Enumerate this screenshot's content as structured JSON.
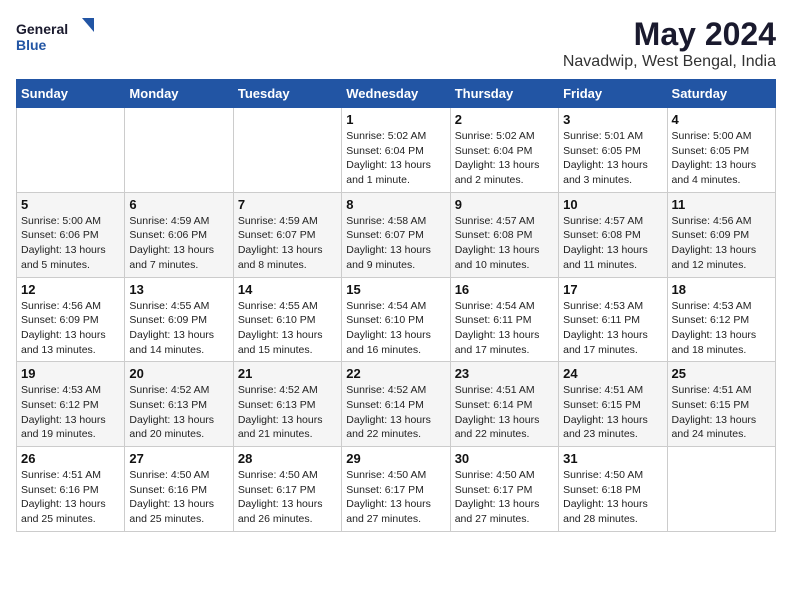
{
  "logo": {
    "line1": "General",
    "line2": "Blue"
  },
  "title": "May 2024",
  "subtitle": "Navadwip, West Bengal, India",
  "headers": [
    "Sunday",
    "Monday",
    "Tuesday",
    "Wednesday",
    "Thursday",
    "Friday",
    "Saturday"
  ],
  "weeks": [
    [
      {
        "day": "",
        "info": ""
      },
      {
        "day": "",
        "info": ""
      },
      {
        "day": "",
        "info": ""
      },
      {
        "day": "1",
        "info": "Sunrise: 5:02 AM\nSunset: 6:04 PM\nDaylight: 13 hours and 1 minute."
      },
      {
        "day": "2",
        "info": "Sunrise: 5:02 AM\nSunset: 6:04 PM\nDaylight: 13 hours and 2 minutes."
      },
      {
        "day": "3",
        "info": "Sunrise: 5:01 AM\nSunset: 6:05 PM\nDaylight: 13 hours and 3 minutes."
      },
      {
        "day": "4",
        "info": "Sunrise: 5:00 AM\nSunset: 6:05 PM\nDaylight: 13 hours and 4 minutes."
      }
    ],
    [
      {
        "day": "5",
        "info": "Sunrise: 5:00 AM\nSunset: 6:06 PM\nDaylight: 13 hours and 5 minutes."
      },
      {
        "day": "6",
        "info": "Sunrise: 4:59 AM\nSunset: 6:06 PM\nDaylight: 13 hours and 7 minutes."
      },
      {
        "day": "7",
        "info": "Sunrise: 4:59 AM\nSunset: 6:07 PM\nDaylight: 13 hours and 8 minutes."
      },
      {
        "day": "8",
        "info": "Sunrise: 4:58 AM\nSunset: 6:07 PM\nDaylight: 13 hours and 9 minutes."
      },
      {
        "day": "9",
        "info": "Sunrise: 4:57 AM\nSunset: 6:08 PM\nDaylight: 13 hours and 10 minutes."
      },
      {
        "day": "10",
        "info": "Sunrise: 4:57 AM\nSunset: 6:08 PM\nDaylight: 13 hours and 11 minutes."
      },
      {
        "day": "11",
        "info": "Sunrise: 4:56 AM\nSunset: 6:09 PM\nDaylight: 13 hours and 12 minutes."
      }
    ],
    [
      {
        "day": "12",
        "info": "Sunrise: 4:56 AM\nSunset: 6:09 PM\nDaylight: 13 hours and 13 minutes."
      },
      {
        "day": "13",
        "info": "Sunrise: 4:55 AM\nSunset: 6:09 PM\nDaylight: 13 hours and 14 minutes."
      },
      {
        "day": "14",
        "info": "Sunrise: 4:55 AM\nSunset: 6:10 PM\nDaylight: 13 hours and 15 minutes."
      },
      {
        "day": "15",
        "info": "Sunrise: 4:54 AM\nSunset: 6:10 PM\nDaylight: 13 hours and 16 minutes."
      },
      {
        "day": "16",
        "info": "Sunrise: 4:54 AM\nSunset: 6:11 PM\nDaylight: 13 hours and 17 minutes."
      },
      {
        "day": "17",
        "info": "Sunrise: 4:53 AM\nSunset: 6:11 PM\nDaylight: 13 hours and 17 minutes."
      },
      {
        "day": "18",
        "info": "Sunrise: 4:53 AM\nSunset: 6:12 PM\nDaylight: 13 hours and 18 minutes."
      }
    ],
    [
      {
        "day": "19",
        "info": "Sunrise: 4:53 AM\nSunset: 6:12 PM\nDaylight: 13 hours and 19 minutes."
      },
      {
        "day": "20",
        "info": "Sunrise: 4:52 AM\nSunset: 6:13 PM\nDaylight: 13 hours and 20 minutes."
      },
      {
        "day": "21",
        "info": "Sunrise: 4:52 AM\nSunset: 6:13 PM\nDaylight: 13 hours and 21 minutes."
      },
      {
        "day": "22",
        "info": "Sunrise: 4:52 AM\nSunset: 6:14 PM\nDaylight: 13 hours and 22 minutes."
      },
      {
        "day": "23",
        "info": "Sunrise: 4:51 AM\nSunset: 6:14 PM\nDaylight: 13 hours and 22 minutes."
      },
      {
        "day": "24",
        "info": "Sunrise: 4:51 AM\nSunset: 6:15 PM\nDaylight: 13 hours and 23 minutes."
      },
      {
        "day": "25",
        "info": "Sunrise: 4:51 AM\nSunset: 6:15 PM\nDaylight: 13 hours and 24 minutes."
      }
    ],
    [
      {
        "day": "26",
        "info": "Sunrise: 4:51 AM\nSunset: 6:16 PM\nDaylight: 13 hours and 25 minutes."
      },
      {
        "day": "27",
        "info": "Sunrise: 4:50 AM\nSunset: 6:16 PM\nDaylight: 13 hours and 25 minutes."
      },
      {
        "day": "28",
        "info": "Sunrise: 4:50 AM\nSunset: 6:17 PM\nDaylight: 13 hours and 26 minutes."
      },
      {
        "day": "29",
        "info": "Sunrise: 4:50 AM\nSunset: 6:17 PM\nDaylight: 13 hours and 27 minutes."
      },
      {
        "day": "30",
        "info": "Sunrise: 4:50 AM\nSunset: 6:17 PM\nDaylight: 13 hours and 27 minutes."
      },
      {
        "day": "31",
        "info": "Sunrise: 4:50 AM\nSunset: 6:18 PM\nDaylight: 13 hours and 28 minutes."
      },
      {
        "day": "",
        "info": ""
      }
    ]
  ]
}
